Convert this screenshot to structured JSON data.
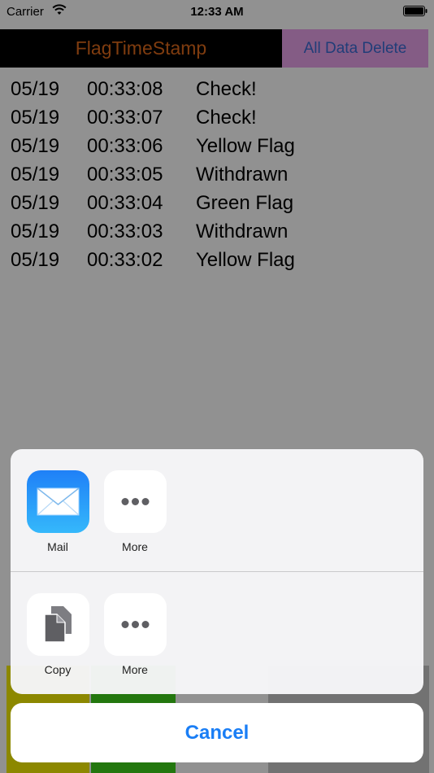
{
  "status_bar": {
    "carrier": "Carrier",
    "time": "12:33 AM",
    "wifi_icon": "wifi-icon",
    "battery_icon": "battery-icon"
  },
  "header": {
    "title": "FlagTimeStamp",
    "delete_label": "All Data Delete",
    "title_color": "#e06a1c",
    "delete_bg": "#e8a3ea"
  },
  "log": [
    {
      "date": "05/19",
      "time": "00:33:08",
      "event": "Check!"
    },
    {
      "date": "05/19",
      "time": "00:33:07",
      "event": "Check!"
    },
    {
      "date": "05/19",
      "time": "00:33:06",
      "event": "Yellow Flag"
    },
    {
      "date": "05/19",
      "time": "00:33:05",
      "event": "Withdrawn"
    },
    {
      "date": "05/19",
      "time": "00:33:04",
      "event": "Green Flag"
    },
    {
      "date": "05/19",
      "time": "00:33:03",
      "event": "Withdrawn"
    },
    {
      "date": "05/19",
      "time": "00:33:02",
      "event": "Yellow Flag"
    }
  ],
  "share_sheet": {
    "share_row": [
      {
        "label": "Mail",
        "icon": "mail-icon"
      },
      {
        "label": "More",
        "icon": "more-icon"
      }
    ],
    "action_row": [
      {
        "label": "Copy",
        "icon": "copy-icon"
      },
      {
        "label": "More",
        "icon": "more-icon"
      }
    ],
    "cancel_label": "Cancel",
    "accent_color": "#1a7ef5"
  },
  "flag_buttons": [
    {
      "color": "#f7f000"
    },
    {
      "color": "#3fd21a"
    },
    {
      "color": "#ffffff"
    },
    {
      "color": "#c8c8c8"
    }
  ]
}
